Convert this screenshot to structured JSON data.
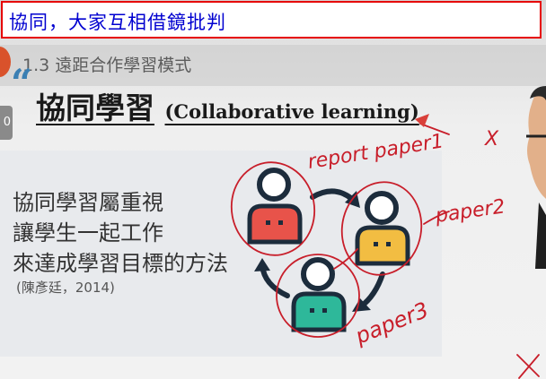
{
  "caption": {
    "text": "協同，大家互相借鏡批判",
    "text_color": "#0000d0",
    "border_color": "#e60000"
  },
  "sidebar": {
    "badge": "0"
  },
  "slide": {
    "section": "1.3 遠距合作學習模式",
    "quote_mark": "“",
    "title_cn": "協同學習",
    "title_en": "(Collaborative learning)",
    "body_lines": [
      "協同學習屬重視",
      "讓學生一起工作",
      "來達成學習目標的方法"
    ],
    "citation": "(陳彥廷，2014)",
    "accent_color": "#3a7fb3"
  },
  "diagram": {
    "icons": [
      {
        "name": "person-red-icon",
        "color": "#e8534a"
      },
      {
        "name": "person-yellow-icon",
        "color": "#f2bd42"
      },
      {
        "name": "person-teal-icon",
        "color": "#2eb89a"
      }
    ],
    "arrow_color": "#1c2c3c"
  },
  "annotations": {
    "ink_color": "#c81e2a",
    "labels": [
      "report paper1",
      "X",
      "paper2",
      "paper3"
    ]
  }
}
